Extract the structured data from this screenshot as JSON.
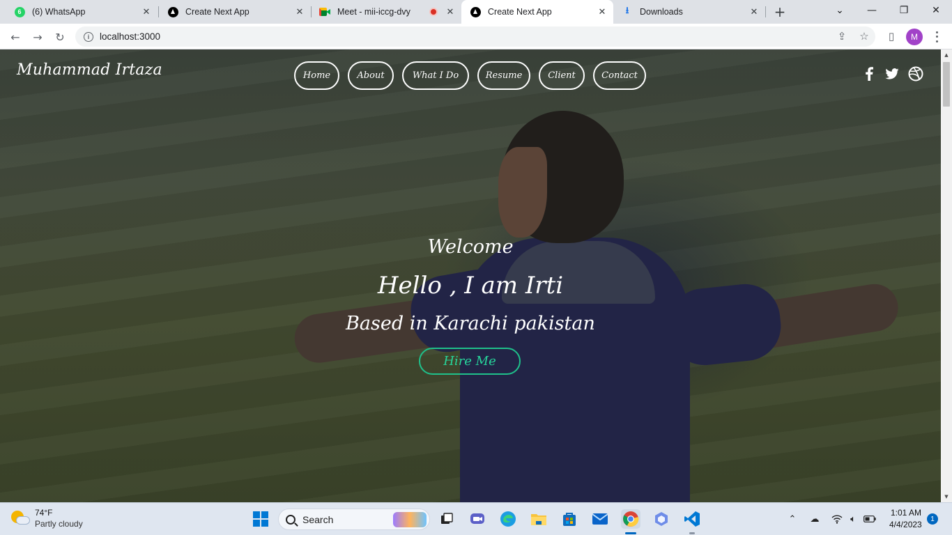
{
  "browser": {
    "tabs": [
      {
        "title": "(6) WhatsApp",
        "favicon": "whatsapp-icon",
        "badge": "6"
      },
      {
        "title": "Create Next App",
        "favicon": "nextjs-icon"
      },
      {
        "title": "Meet - mii-iccg-dvy",
        "favicon": "google-meet-icon",
        "recording": true
      },
      {
        "title": "Create Next App",
        "favicon": "nextjs-icon",
        "active": true
      },
      {
        "title": "Downloads",
        "favicon": "download-icon"
      }
    ],
    "address": "localhost:3000",
    "profile_initial": "M"
  },
  "site": {
    "brand": "Muhammad Irtaza",
    "nav": [
      "Home",
      "About",
      "What I Do",
      "Resume",
      "Client",
      "Contact"
    ],
    "social": [
      "facebook-icon",
      "twitter-icon",
      "dribbble-icon"
    ],
    "hero": {
      "welcome": "Welcome",
      "hello": "Hello , I am Irti",
      "based": "Based in Karachi pakistan",
      "cta": "Hire Me"
    },
    "accent_color": "#1fc18b"
  },
  "taskbar": {
    "weather": {
      "temp": "74°F",
      "condition": "Partly cloudy"
    },
    "search_placeholder": "Search",
    "time": "1:01 AM",
    "date": "4/4/2023",
    "notifications": "1"
  }
}
